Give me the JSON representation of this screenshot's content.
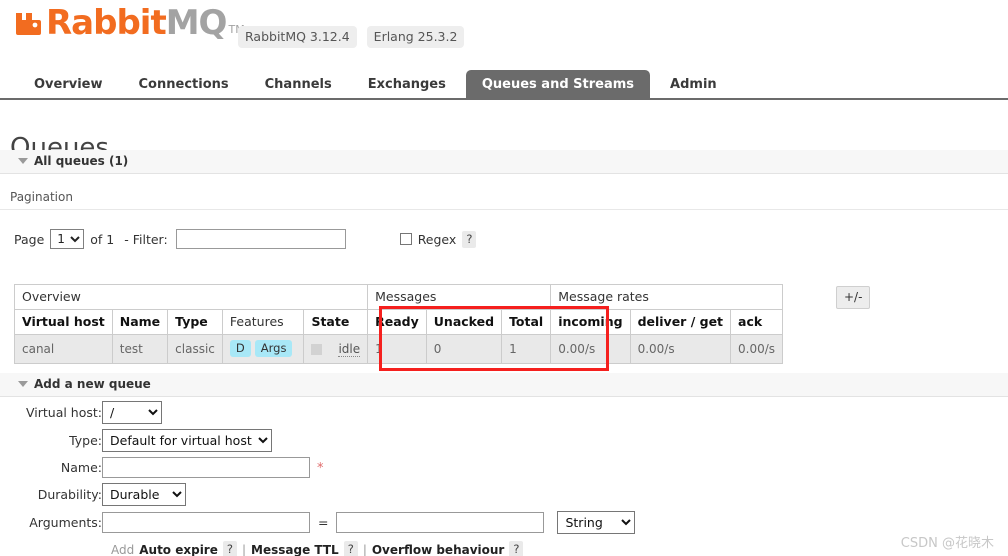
{
  "header": {
    "logo_rabbit": "Rabbit",
    "logo_mq": "MQ",
    "logo_tm": "TM",
    "badges": [
      {
        "label": "RabbitMQ 3.12.4"
      },
      {
        "label": "Erlang 25.3.2"
      }
    ]
  },
  "nav": {
    "tabs": [
      {
        "label": "Overview",
        "active": false
      },
      {
        "label": "Connections",
        "active": false
      },
      {
        "label": "Channels",
        "active": false
      },
      {
        "label": "Exchanges",
        "active": false
      },
      {
        "label": "Queues and Streams",
        "active": true
      },
      {
        "label": "Admin",
        "active": false
      }
    ]
  },
  "page": {
    "title": "Queues",
    "all_queues_label": "All queues (1)",
    "pagination_label": "Pagination"
  },
  "pagination": {
    "page_label": "Page",
    "page_value": "1",
    "page_options": [
      "1"
    ],
    "of_label": "of 1",
    "filter_label": "- Filter:",
    "filter_value": "",
    "regex_label": "Regex",
    "help_label": "?"
  },
  "table": {
    "groups": [
      {
        "label": "Overview",
        "span": 5
      },
      {
        "label": "Messages",
        "span": 3
      },
      {
        "label": "Message rates",
        "span": 3
      }
    ],
    "columns": [
      {
        "label": "Virtual host",
        "bold": true,
        "align": "left"
      },
      {
        "label": "Name",
        "bold": true,
        "align": "left"
      },
      {
        "label": "Type",
        "bold": true,
        "align": "left"
      },
      {
        "label": "Features",
        "bold": false,
        "align": "left"
      },
      {
        "label": "State",
        "bold": true,
        "align": "left"
      },
      {
        "label": "Ready",
        "bold": true,
        "align": "left"
      },
      {
        "label": "Unacked",
        "bold": true,
        "align": "left"
      },
      {
        "label": "Total",
        "bold": true,
        "align": "left"
      },
      {
        "label": "incoming",
        "bold": true,
        "align": "left"
      },
      {
        "label": "deliver / get",
        "bold": true,
        "align": "left"
      },
      {
        "label": "ack",
        "bold": true,
        "align": "left"
      }
    ],
    "rows": [
      {
        "vhost": "canal",
        "name": "test",
        "type": "classic",
        "features": [
          "D",
          "Args"
        ],
        "state": "idle",
        "ready": "1",
        "unacked": "0",
        "total": "1",
        "incoming": "0.00/s",
        "deliver_get": "0.00/s",
        "ack": "0.00/s"
      }
    ],
    "toggle_columns_label": "+/-"
  },
  "add_queue": {
    "section_label": "Add a new queue",
    "vhost_label": "Virtual host:",
    "vhost_value": "/",
    "vhost_options": [
      "/"
    ],
    "type_label": "Type:",
    "type_value": "Default for virtual host",
    "type_options": [
      "Default for virtual host"
    ],
    "name_label": "Name:",
    "name_value": "",
    "name_required": "*",
    "durability_label": "Durability:",
    "durability_value": "Durable",
    "durability_options": [
      "Durable"
    ],
    "arguments_label": "Arguments:",
    "argument_key": "",
    "argument_value": "",
    "argument_equals": "=",
    "argument_type_value": "String",
    "argument_type_options": [
      "String"
    ],
    "add_link": "Add",
    "presets": [
      {
        "label": "Auto expire",
        "help": "?"
      },
      {
        "label": "Message TTL",
        "help": "?"
      },
      {
        "label": "Overflow behaviour",
        "help": "?"
      }
    ],
    "preset_separator": "|"
  },
  "watermark": {
    "text": "CSDN @花晓木"
  },
  "colors": {
    "brand_orange": "#f26c20",
    "active_tab": "#6b6b6b",
    "feature_badge": "#a8e8f7",
    "annotation_red": "#f5201e"
  }
}
